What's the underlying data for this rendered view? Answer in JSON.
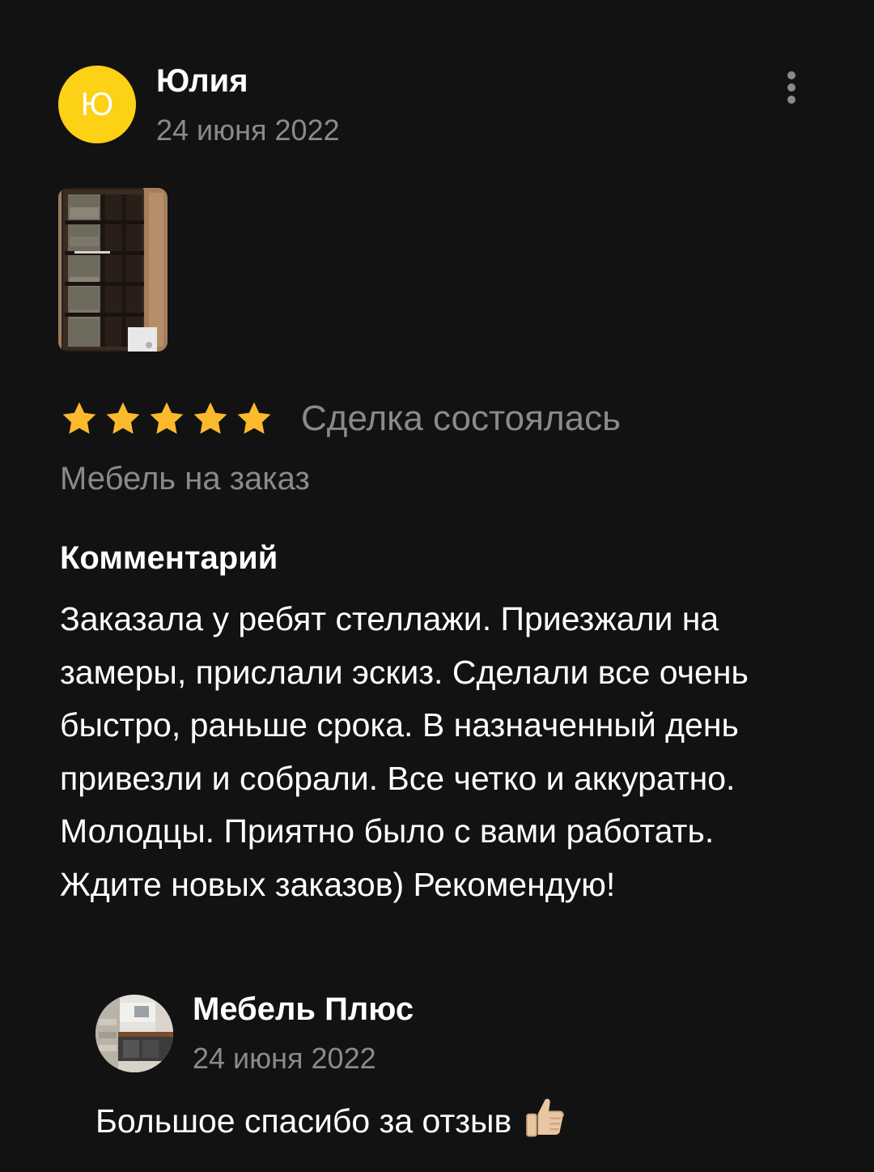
{
  "review": {
    "author": {
      "initial": "Ю",
      "name": "Юлия",
      "avatar_color": "#fcd116"
    },
    "date": "24 июня 2022",
    "more_icon": "more-vertical-icon",
    "photo": {
      "description_icon": "photo-thumbnail"
    },
    "rating": {
      "stars": 5,
      "max": 5,
      "star_color": "#fcb92c"
    },
    "deal_status": "Сделка состоялась",
    "category": "Мебель на заказ",
    "comment_heading": "Комментарий",
    "comment_text": "Заказала у ребят стеллажи. Приезжали на замеры, прислали эскиз. Сделали все очень быстро, раньше срока. В назначенный день привезли и собрали. Все четко и аккуратно. Молодцы. Приятно было с вами работать. Ждите новых заказов) Рекомендую!"
  },
  "reply": {
    "author_name": "Мебель Плюс",
    "date": "24 июня 2022",
    "text": "Большое спасибо за отзыв",
    "emoji_icon": "thumbs-up-icon"
  }
}
